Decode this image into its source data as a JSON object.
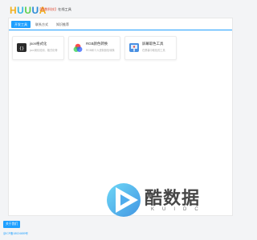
{
  "header": {
    "logo_letters": [
      {
        "char": "H",
        "color": "#f2b01e"
      },
      {
        "char": "U",
        "color": "#33b5e5"
      },
      {
        "char": "U",
        "color": "#5ccf4c"
      },
      {
        "char": "U",
        "color": "#2a8bd6"
      },
      {
        "char": "A",
        "color": "#f2b01e"
      }
    ],
    "site_tag": "【酷数科技】",
    "site_title": "在线工具"
  },
  "tabs": [
    {
      "label": "开发工具",
      "active": true
    },
    {
      "label": "联系方式",
      "active": false
    },
    {
      "label": "知识推荐",
      "active": false
    }
  ],
  "tools": [
    {
      "name": "json格式化",
      "desc": "json美化检测、格式化等",
      "icon": "json-terminal-icon"
    },
    {
      "name": "RGB颜色转换",
      "desc": "RGB和十六进制颜色转换",
      "icon": "rgb-circles-icon"
    },
    {
      "name": "屏幕取色工具",
      "desc": "在屏幕中取色的工具",
      "icon": "color-picker-icon"
    }
  ],
  "bottom": {
    "about_label": "关于我们",
    "footer_link": "京ICP备18024659号"
  },
  "watermark": {
    "text": "酷数据",
    "sub": "KUIDC",
    "icon": "play-logo-icon"
  },
  "colors": {
    "accent": "#1e9fff",
    "page_bg": "#f3f4f6"
  }
}
